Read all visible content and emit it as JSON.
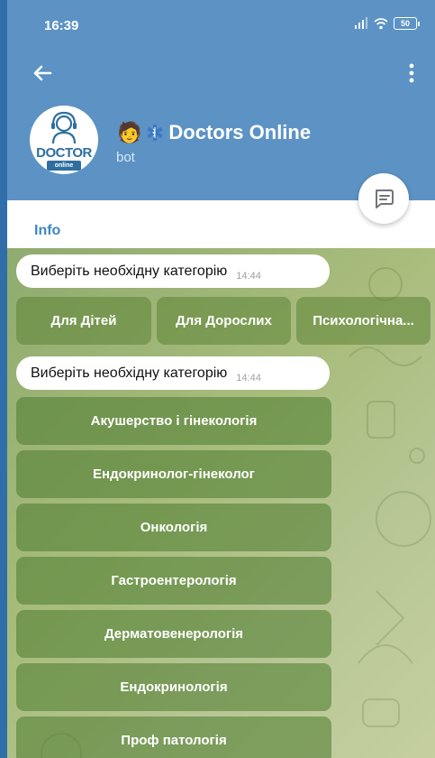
{
  "status_bar": {
    "time": "16:39",
    "battery": "50"
  },
  "header": {
    "avatar_logo": "DOCTOR",
    "avatar_logo_sub": "online",
    "title_emoji": "🧑",
    "title": "Doctors Online",
    "subtitle": "bot",
    "accent_color": "#5c93c4"
  },
  "tabs": {
    "info": "Info"
  },
  "chat": {
    "messages": [
      {
        "text": "Виберіть необхідну категорію",
        "time": "14:44"
      },
      {
        "text": "Виберіть необхідну категорію",
        "time": "14:44"
      }
    ],
    "keyboard_top": [
      "Для Дітей",
      "Для Дорослих",
      "Психологічна..."
    ],
    "keyboard_categories": [
      "Акушерство і гінекологія",
      "Ендокринолог-гінеколог",
      "Онкологія",
      "Гастроентерологія",
      "Дерматовенерологія",
      "Ендокринологія",
      "Проф патологія"
    ],
    "background_color": "#a9bd7d"
  }
}
